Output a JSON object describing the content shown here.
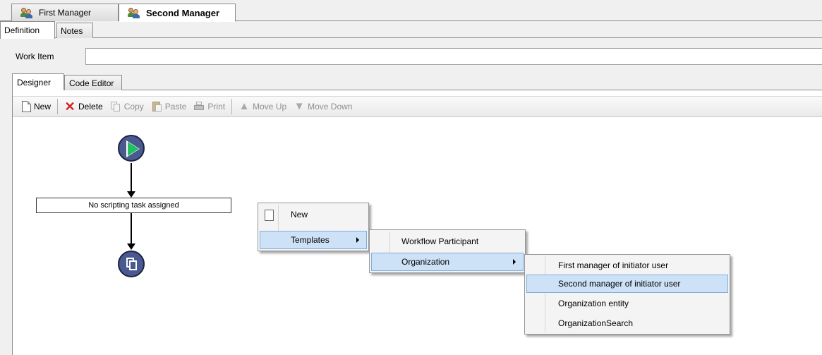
{
  "document_tabs": [
    {
      "label": "First Manager",
      "icon": "users-icon",
      "active": false
    },
    {
      "label": "Second Manager",
      "icon": "users-icon",
      "active": true
    }
  ],
  "sub_tabs": {
    "definition": "Definition",
    "notes": "Notes"
  },
  "work_item": {
    "label": "Work Item",
    "value": ""
  },
  "designer_tabs": {
    "designer": "Designer",
    "code_editor": "Code Editor"
  },
  "toolbar": {
    "new": "New",
    "delete": "Delete",
    "copy": "Copy",
    "paste": "Paste",
    "print": "Print",
    "move_up": "Move Up",
    "move_down": "Move Down"
  },
  "workflow": {
    "task_label": "No scripting task assigned"
  },
  "context_menu": {
    "level1": {
      "new": "New",
      "templates": "Templates"
    },
    "level2": {
      "workflow_participant": "Workflow Participant",
      "organization": "Organization"
    },
    "level3": {
      "first_manager": "First manager of initiator user",
      "second_manager": "Second manager of initiator user",
      "organization_entity": "Organization entity",
      "organization_search": "OrganizationSearch"
    }
  },
  "colors": {
    "highlight": "#cde1f7",
    "node_fill": "#4a5a90",
    "start_arrow": "#22c060",
    "delete_icon": "#d42020"
  }
}
